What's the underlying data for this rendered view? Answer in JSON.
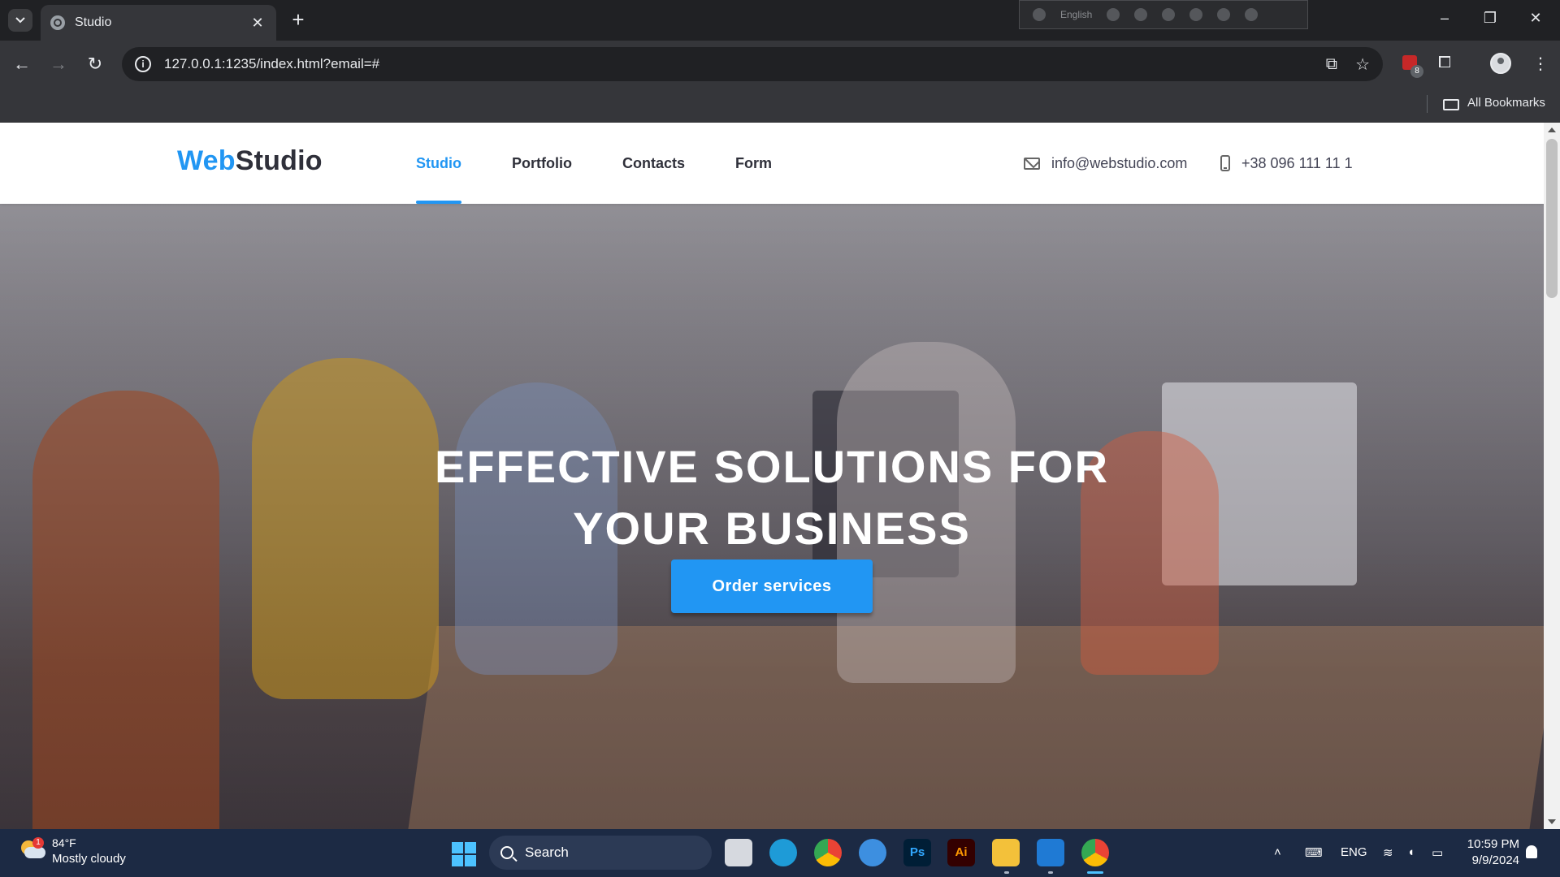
{
  "browser": {
    "tab_title": "Studio",
    "new_tab_symbol": "+",
    "close_symbol": "✕",
    "url": "127.0.0.1:1235/index.html?email=#",
    "extension_panel_lang": "English",
    "extension_badge": "8",
    "bookmarks_label": "All Bookmarks"
  },
  "site": {
    "logo_accent": "Web",
    "logo_main": "Studio",
    "nav": [
      {
        "label": "Studio",
        "active": true
      },
      {
        "label": "Portfolio",
        "active": false
      },
      {
        "label": "Contacts",
        "active": false
      },
      {
        "label": "Form",
        "active": false
      }
    ],
    "email": "info@webstudio.com",
    "phone": "+38 096 111 11 1",
    "accent_color": "#2196f3",
    "text_color": "#2f303a"
  },
  "hero": {
    "title_line1": "EFFECTIVE SOLUTIONS FOR",
    "title_line2": "YOUR BUSINESS",
    "cta_label": "Order services"
  },
  "taskbar": {
    "weather_badge": "1",
    "weather_temp": "84°F",
    "weather_desc": "Mostly cloudy",
    "search_label": "Search",
    "apps": [
      {
        "name": "task-view",
        "label": ""
      },
      {
        "name": "edge",
        "label": ""
      },
      {
        "name": "chrome",
        "label": ""
      },
      {
        "name": "browser-alt",
        "label": ""
      },
      {
        "name": "photoshop",
        "label": "Ps"
      },
      {
        "name": "illustrator",
        "label": "Ai"
      },
      {
        "name": "file-explorer",
        "label": ""
      },
      {
        "name": "vscode",
        "label": ""
      },
      {
        "name": "chrome-active",
        "label": ""
      }
    ],
    "language": "ENG",
    "time": "10:59 PM",
    "date": "9/9/2024"
  }
}
